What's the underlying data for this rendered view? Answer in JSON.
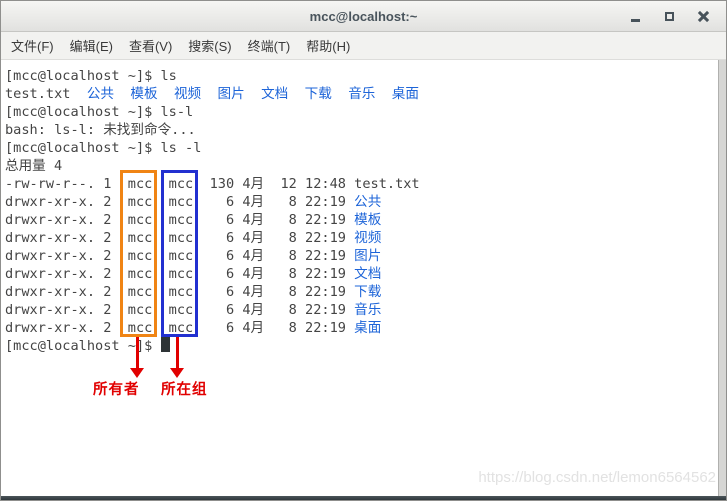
{
  "window": {
    "title": "mcc@localhost:~"
  },
  "menu": {
    "items": [
      "文件(F)",
      "编辑(E)",
      "查看(V)",
      "搜索(S)",
      "终端(T)",
      "帮助(H)"
    ]
  },
  "terminal": {
    "lines": [
      {
        "segments": [
          {
            "text": "[mcc@localhost ~]$ ls",
            "style": "plain"
          }
        ]
      },
      {
        "segments": [
          {
            "text": "test.txt  ",
            "style": "plain"
          },
          {
            "text": "公共",
            "style": "dir"
          },
          {
            "text": "  ",
            "style": "plain"
          },
          {
            "text": "模板",
            "style": "dir"
          },
          {
            "text": "  ",
            "style": "plain"
          },
          {
            "text": "视频",
            "style": "dir"
          },
          {
            "text": "  ",
            "style": "plain"
          },
          {
            "text": "图片",
            "style": "dir"
          },
          {
            "text": "  ",
            "style": "plain"
          },
          {
            "text": "文档",
            "style": "dir"
          },
          {
            "text": "  ",
            "style": "plain"
          },
          {
            "text": "下载",
            "style": "dir"
          },
          {
            "text": "  ",
            "style": "plain"
          },
          {
            "text": "音乐",
            "style": "dir"
          },
          {
            "text": "  ",
            "style": "plain"
          },
          {
            "text": "桌面",
            "style": "dir"
          }
        ]
      },
      {
        "segments": [
          {
            "text": "[mcc@localhost ~]$ ls-l",
            "style": "plain"
          }
        ]
      },
      {
        "segments": [
          {
            "text": "bash: ls-l: 未找到命令...",
            "style": "plain"
          }
        ]
      },
      {
        "segments": [
          {
            "text": "[mcc@localhost ~]$ ls -l",
            "style": "plain"
          }
        ]
      },
      {
        "segments": [
          {
            "text": "总用量 4",
            "style": "plain"
          }
        ]
      },
      {
        "segments": [
          {
            "text": "-rw-rw-r--. 1  mcc  mcc  130 4月  12 12:48 test.txt",
            "style": "plain"
          }
        ]
      },
      {
        "segments": [
          {
            "text": "drwxr-xr-x. 2  mcc  mcc    6 4月   8 22:19 ",
            "style": "plain"
          },
          {
            "text": "公共",
            "style": "dir"
          }
        ]
      },
      {
        "segments": [
          {
            "text": "drwxr-xr-x. 2  mcc  mcc    6 4月   8 22:19 ",
            "style": "plain"
          },
          {
            "text": "模板",
            "style": "dir"
          }
        ]
      },
      {
        "segments": [
          {
            "text": "drwxr-xr-x. 2  mcc  mcc    6 4月   8 22:19 ",
            "style": "plain"
          },
          {
            "text": "视频",
            "style": "dir"
          }
        ]
      },
      {
        "segments": [
          {
            "text": "drwxr-xr-x. 2  mcc  mcc    6 4月   8 22:19 ",
            "style": "plain"
          },
          {
            "text": "图片",
            "style": "dir"
          }
        ]
      },
      {
        "segments": [
          {
            "text": "drwxr-xr-x. 2  mcc  mcc    6 4月   8 22:19 ",
            "style": "plain"
          },
          {
            "text": "文档",
            "style": "dir"
          }
        ]
      },
      {
        "segments": [
          {
            "text": "drwxr-xr-x. 2  mcc  mcc    6 4月   8 22:19 ",
            "style": "plain"
          },
          {
            "text": "下载",
            "style": "dir"
          }
        ]
      },
      {
        "segments": [
          {
            "text": "drwxr-xr-x. 2  mcc  mcc    6 4月   8 22:19 ",
            "style": "plain"
          },
          {
            "text": "音乐",
            "style": "dir"
          }
        ]
      },
      {
        "segments": [
          {
            "text": "drwxr-xr-x. 2  mcc  mcc    6 4月   8 22:19 ",
            "style": "plain"
          },
          {
            "text": "桌面",
            "style": "dir"
          }
        ]
      },
      {
        "segments": [
          {
            "text": "[mcc@localhost ~]$ ",
            "style": "plain"
          },
          {
            "text": "",
            "style": "cursor"
          }
        ]
      }
    ]
  },
  "annotations": {
    "owner_label": "所有者",
    "group_label": "所在组"
  },
  "colors": {
    "dir_text": "#1d64d8",
    "owner_box": "#f08414",
    "group_box": "#2230d0",
    "annotation_red": "#e10000",
    "terminal_text": "#444444"
  },
  "watermark": "https://blog.csdn.net/lemon6564562"
}
